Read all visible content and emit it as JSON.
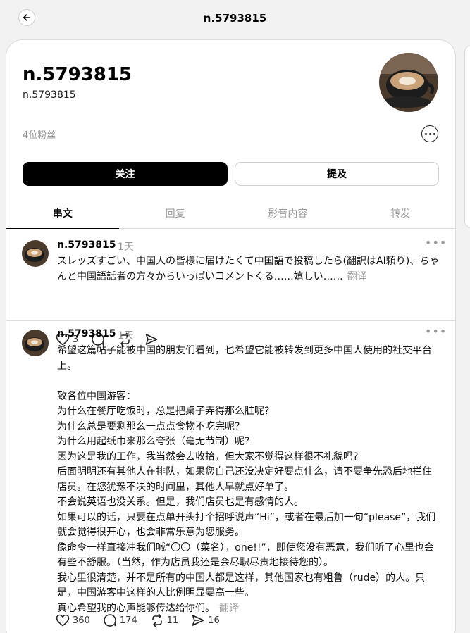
{
  "header": {
    "title": "n.5793815"
  },
  "profile": {
    "name": "n.5793815",
    "handle": "n.5793815",
    "followers": "4位粉丝",
    "follow_label": "关注",
    "mention_label": "提及"
  },
  "tabs": [
    {
      "label": "串文"
    },
    {
      "label": "回复"
    },
    {
      "label": "影音内容"
    },
    {
      "label": "转发"
    }
  ],
  "posts": [
    {
      "author": "n.5793815",
      "time": "1天",
      "text": "スレッズすごい、中国人の皆様に届けたくて中国語で投稿したら(翻訳はAI頼り)、ちゃんと中国語話者の方々からいっぱいコメントくる……嬉しい……",
      "translate": "翻译",
      "likes": "3",
      "comments": "",
      "reposts": "",
      "shares": ""
    },
    {
      "author": "n.5793815",
      "time": "1天",
      "text": "希望这篇帖子能被中国的朋友们看到，也希望它能被转发到更多中国人使用的社交平台上。\n\n致各位中国游客：\n为什么在餐厅吃饭时，总是把桌子弄得那么脏呢?\n为什么总是要剩那么一点点食物不吃完呢?\n为什么用起纸巾来那么夸张（毫无节制）呢?\n因为这是我的工作，我当然会去收拾，但大家不觉得这样很不礼貌吗?\n后面明明还有其他人在排队，如果您自己还没决定好要点什么，请不要争先恐后地拦住店员。在您犹豫不决的时间里，其他人早就点好单了。\n不会说英语也没关系。但是，我们店员也是有感情的人。\n如果可以的话，只要在点单开头打个招呼说声“Hi”，或者在最后加一句“please”，我们就会觉得很开心，也会非常乐意为您服务。\n像命令一样直接冲我们喊“〇〇（菜名），one!!”，即使您没有恶意，我们听了心里也会有些不舒服。（当然，作为店员我还是会尽职尽责地接待您的）。\n我心里很清楚，并不是所有的中国人都是这样，其他国家也有粗鲁（rude）的人。只是，中国游客中这样的人比例明显要高一些。\n真心希望我的心声能够传达给你们。",
      "translate": "翻译",
      "likes": "360",
      "comments": "174",
      "reposts": "11",
      "shares": "16"
    }
  ]
}
